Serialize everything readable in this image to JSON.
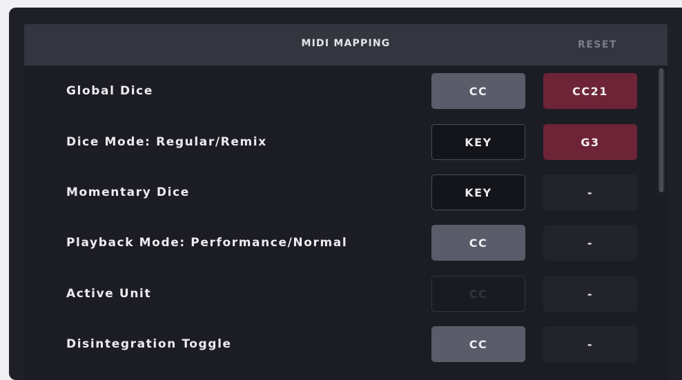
{
  "header": {
    "title": "MIDI MAPPING",
    "reset_label": "RESET"
  },
  "rows": [
    {
      "label": "Global Dice",
      "type": "CC",
      "value": "CC21"
    },
    {
      "label": "Dice Mode: Regular/Remix",
      "type": "KEY",
      "value": "G3"
    },
    {
      "label": "Momentary Dice",
      "type": "KEY",
      "value": "-"
    },
    {
      "label": "Playback Mode: Performance/Normal",
      "type": "CC",
      "value": "-"
    },
    {
      "label": "Active Unit",
      "type": "CC",
      "value": "-"
    },
    {
      "label": "Disintegration Toggle",
      "type": "CC",
      "value": "-"
    }
  ],
  "colors": {
    "panel_background": "#1f2027",
    "header_background": "#33353f",
    "assigned_value": "#6c2436",
    "type_filled": "#5b5c69"
  }
}
